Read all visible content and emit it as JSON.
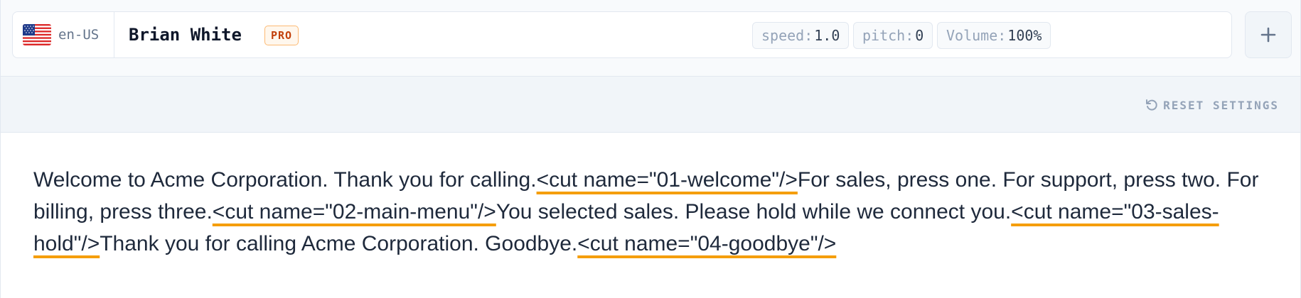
{
  "voice": {
    "locale": "en-US",
    "name": "Brian White",
    "tier_badge": "PRO",
    "flag_icon": "us-flag-icon"
  },
  "params": [
    {
      "key": "speed:",
      "value": "1.0"
    },
    {
      "key": "pitch:",
      "value": "0"
    },
    {
      "key": "Volume:",
      "value": "100%"
    }
  ],
  "actions": {
    "add_icon": "plus-icon",
    "reset_label": "RESET SETTINGS",
    "reset_icon": "reset-icon"
  },
  "script": {
    "segments": [
      {
        "type": "text",
        "value": "Welcome to Acme Corporation. Thank you for calling."
      },
      {
        "type": "cut",
        "value": "<cut name=\"01-welcome\"/>"
      },
      {
        "type": "text",
        "value": "For sales, press one. For support, press two. For billing, press three."
      },
      {
        "type": "cut",
        "value": "<cut name=\"02-main-menu\"/>"
      },
      {
        "type": "text",
        "value": "You selected sales. Please hold while we connect you."
      },
      {
        "type": "cut",
        "value": "<cut name=\"03-sales-hold\"/>"
      },
      {
        "type": "text",
        "value": "Thank you for calling Acme Corporation. Goodbye."
      },
      {
        "type": "cut",
        "value": "<cut name=\"04-goodbye\"/>"
      }
    ]
  },
  "colors": {
    "cut_underline": "#f59e0b",
    "badge_border": "#fdba74",
    "badge_text": "#c2410c"
  }
}
